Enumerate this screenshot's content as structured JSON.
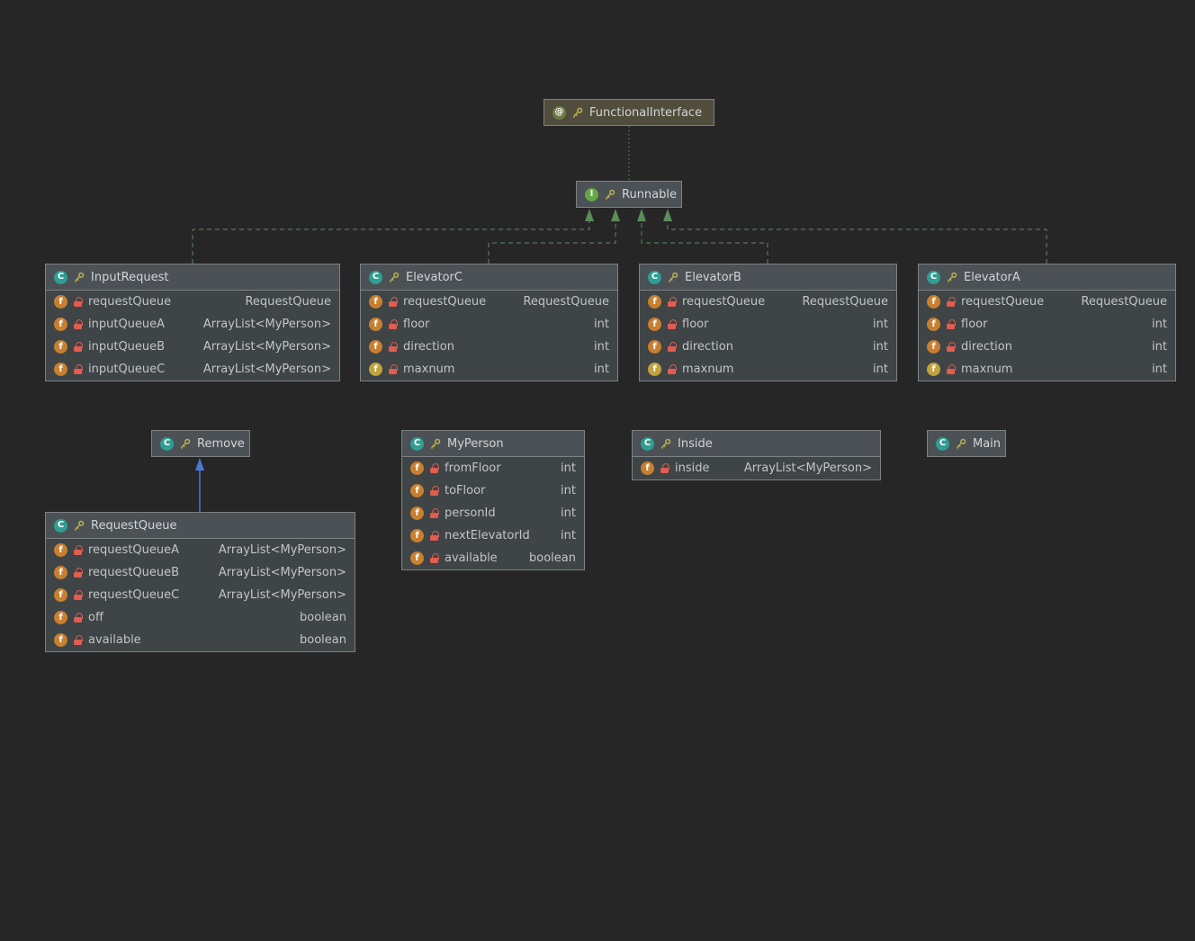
{
  "icons": {
    "class_letter": "C",
    "interface_letter": "I",
    "annotation_letter": "@",
    "field_letter": "f"
  },
  "colors": {
    "background": "#262626",
    "implements_edge": "#5b8c5a",
    "annotation_edge": "#5b8c5a",
    "extends_edge": "#4a78d6",
    "box_body": "#3f4447",
    "box_header": "#4c5156"
  },
  "diagram": {
    "annotation": {
      "name": "FunctionalInterface"
    },
    "interface": {
      "name": "Runnable"
    },
    "classes": [
      {
        "name": "InputRequest",
        "fields": [
          {
            "name": "requestQueue",
            "type": "RequestQueue"
          },
          {
            "name": "inputQueueA",
            "type": "ArrayList<MyPerson>"
          },
          {
            "name": "inputQueueB",
            "type": "ArrayList<MyPerson>"
          },
          {
            "name": "inputQueueC",
            "type": "ArrayList<MyPerson>"
          }
        ]
      },
      {
        "name": "ElevatorC",
        "fields": [
          {
            "name": "requestQueue",
            "type": "RequestQueue"
          },
          {
            "name": "floor",
            "type": "int"
          },
          {
            "name": "direction",
            "type": "int"
          },
          {
            "name": "maxnum",
            "type": "int"
          }
        ]
      },
      {
        "name": "ElevatorB",
        "fields": [
          {
            "name": "requestQueue",
            "type": "RequestQueue"
          },
          {
            "name": "floor",
            "type": "int"
          },
          {
            "name": "direction",
            "type": "int"
          },
          {
            "name": "maxnum",
            "type": "int"
          }
        ]
      },
      {
        "name": "ElevatorA",
        "fields": [
          {
            "name": "requestQueue",
            "type": "RequestQueue"
          },
          {
            "name": "floor",
            "type": "int"
          },
          {
            "name": "direction",
            "type": "int"
          },
          {
            "name": "maxnum",
            "type": "int"
          }
        ]
      },
      {
        "name": "Remove",
        "fields": []
      },
      {
        "name": "MyPerson",
        "fields": [
          {
            "name": "fromFloor",
            "type": "int"
          },
          {
            "name": "toFloor",
            "type": "int"
          },
          {
            "name": "personId",
            "type": "int"
          },
          {
            "name": "nextElevatorId",
            "type": "int"
          },
          {
            "name": "available",
            "type": "boolean"
          }
        ]
      },
      {
        "name": "Inside",
        "fields": [
          {
            "name": "inside",
            "type": "ArrayList<MyPerson>"
          }
        ]
      },
      {
        "name": "Main",
        "fields": []
      },
      {
        "name": "RequestQueue",
        "fields": [
          {
            "name": "requestQueueA",
            "type": "ArrayList<MyPerson>"
          },
          {
            "name": "requestQueueB",
            "type": "ArrayList<MyPerson>"
          },
          {
            "name": "requestQueueC",
            "type": "ArrayList<MyPerson>"
          },
          {
            "name": "off",
            "type": "boolean"
          },
          {
            "name": "available",
            "type": "boolean"
          }
        ]
      }
    ],
    "relationships": [
      {
        "from": "Runnable",
        "to": "FunctionalInterface",
        "kind": "annotated-by"
      },
      {
        "from": "InputRequest",
        "to": "Runnable",
        "kind": "implements"
      },
      {
        "from": "ElevatorC",
        "to": "Runnable",
        "kind": "implements"
      },
      {
        "from": "ElevatorB",
        "to": "Runnable",
        "kind": "implements"
      },
      {
        "from": "ElevatorA",
        "to": "Runnable",
        "kind": "implements"
      },
      {
        "from": "RequestQueue",
        "to": "Remove",
        "kind": "extends"
      }
    ]
  }
}
